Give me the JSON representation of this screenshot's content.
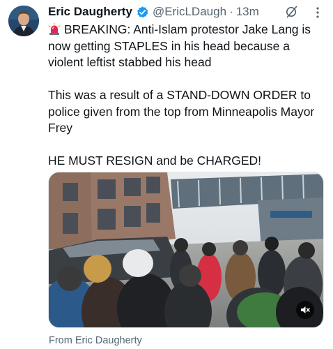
{
  "tweet": {
    "author_name": "Eric Daugherty",
    "handle": "@EricLDaugh",
    "separator": "·",
    "time": "13m",
    "verified": true,
    "paragraphs": [
      "BREAKING: Anti-Islam protestor Jake Lang is now getting STAPLES in his head because a violent leftist stabbed his head",
      "This was a result of a STAND-DOWN ORDER to police given from the top from Minneapolis Mayor Frey",
      "HE MUST RESIGN and be CHARGED!"
    ],
    "leading_emoji": "siren-icon",
    "media": {
      "type": "video",
      "muted": true,
      "mute_icon": "speaker-muted-icon"
    },
    "attribution": "From Eric Daugherty"
  },
  "colors": {
    "text": "#0f1419",
    "secondary": "#536471",
    "verified": "#1d9bf0",
    "siren": "#e0245e"
  },
  "icons": {
    "verified": "verified-badge-icon",
    "grok": "grok-icon",
    "more": "more-options-icon"
  }
}
